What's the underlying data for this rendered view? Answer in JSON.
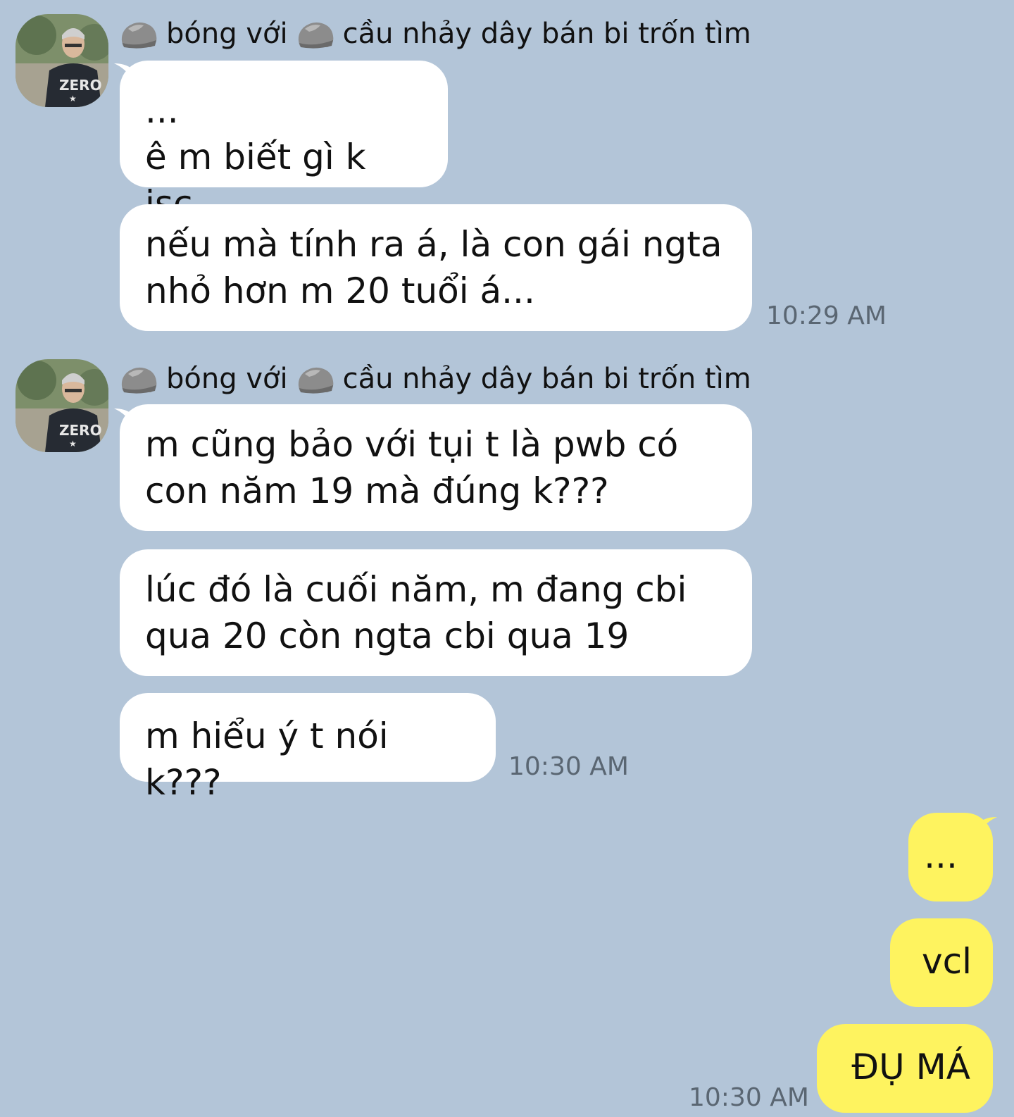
{
  "chat": {
    "groups": [
      {
        "sender": {
          "pre": "bóng với",
          "post": "cầu nhảy dây bán bi trốn tìm",
          "avatar_icon": "avatar-photo"
        },
        "messages": [
          "...\nê m biết gì k jsc",
          "nếu mà tính ra á, là con gái ngta\nnhỏ hơn m 20 tuổi á..."
        ],
        "time": "10:29 AM"
      },
      {
        "sender": {
          "pre": "bóng với",
          "post": "cầu nhảy dây bán bi trốn tìm",
          "avatar_icon": "avatar-photo"
        },
        "messages": [
          "m cũng bảo với tụi t là pwb có\ncon năm 19 mà đúng k???",
          "lúc đó là cuối năm, m đang cbi\nqua 20 còn ngta cbi qua 19",
          "m hiểu ý t nói k???"
        ],
        "time": "10:30 AM"
      }
    ],
    "outgoing": {
      "messages": [
        "...",
        "vcl",
        "ĐỤ MÁ"
      ],
      "time": "10:30 AM"
    }
  },
  "colors": {
    "background": "#b3c5d8",
    "incoming_bubble": "#ffffff",
    "outgoing_bubble": "#fef35f",
    "timestamp": "#5a6672"
  }
}
